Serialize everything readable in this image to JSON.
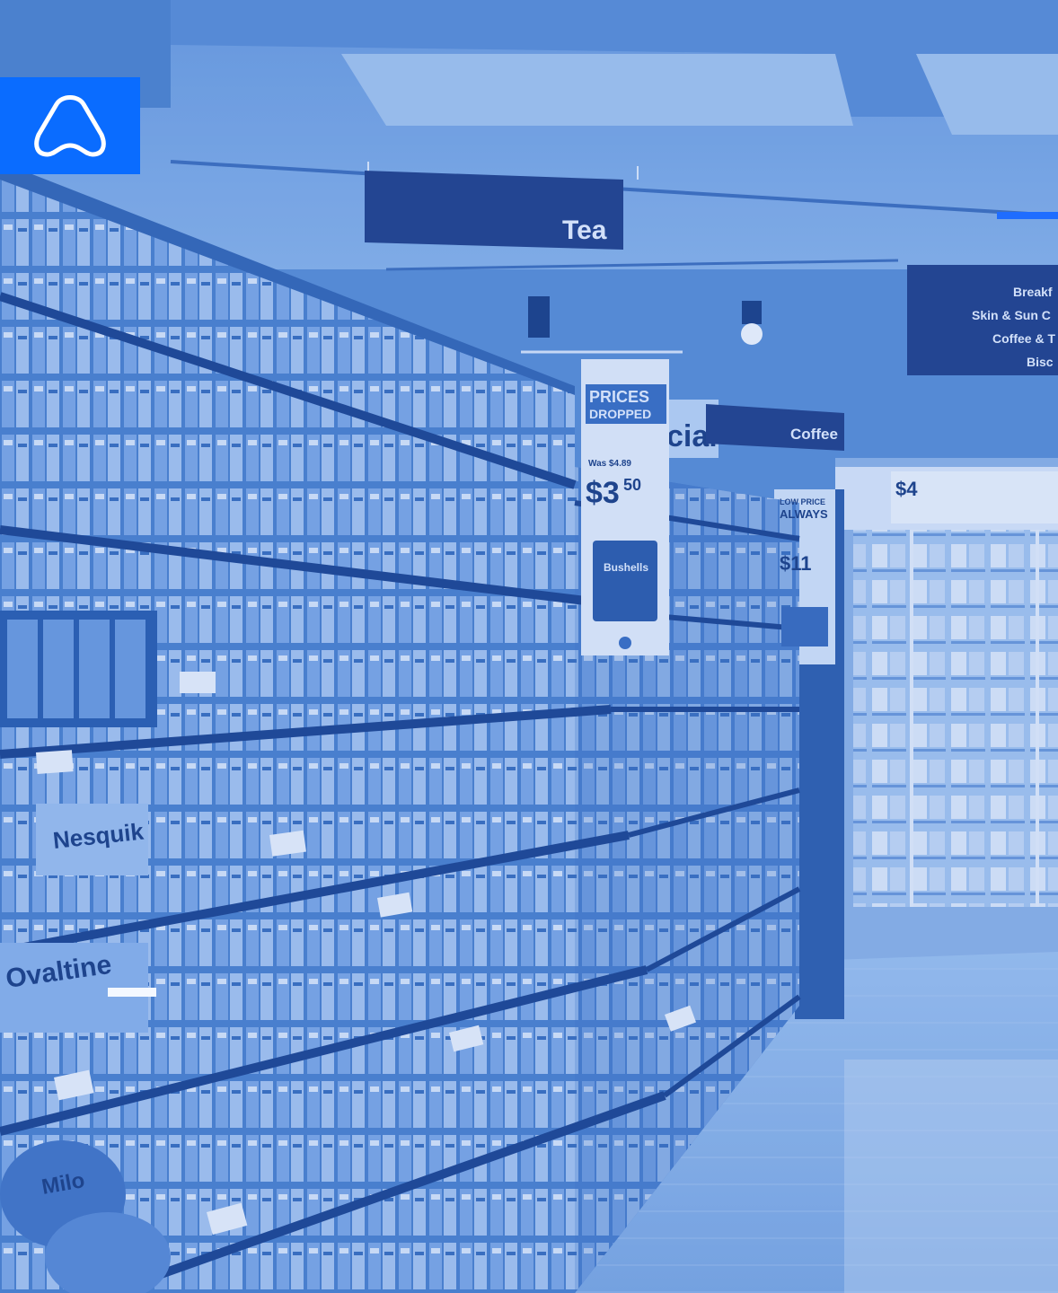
{
  "photo": {
    "aisle_signs": {
      "main": "Tea",
      "secondary": "Coffee",
      "overhead_list": [
        "Breakf",
        "Skin & Sun C",
        "Coffee & T",
        "Bisc"
      ]
    },
    "promo": {
      "headline_line1": "PRICES",
      "headline_line2": "DROPPED",
      "was": "Was $4.89",
      "price_whole": "$3",
      "price_cents": "50",
      "product": "Bushells"
    },
    "price_cards": {
      "low_price_line1": "LOW PRICE",
      "low_price_line2": "ALWAYS",
      "card_price_1": "$11",
      "card_price_2": "$4"
    },
    "packaging": [
      "Nesquik",
      "Ovaltine",
      "Milo"
    ],
    "partial_sign": "cial"
  },
  "colors": {
    "tint": "#5b8fd6",
    "logo_bg": "#0a6cff",
    "accent": "#1f6dff",
    "sign_bg": "#21408a"
  },
  "logo": {
    "icon": "arch-logo-icon"
  }
}
